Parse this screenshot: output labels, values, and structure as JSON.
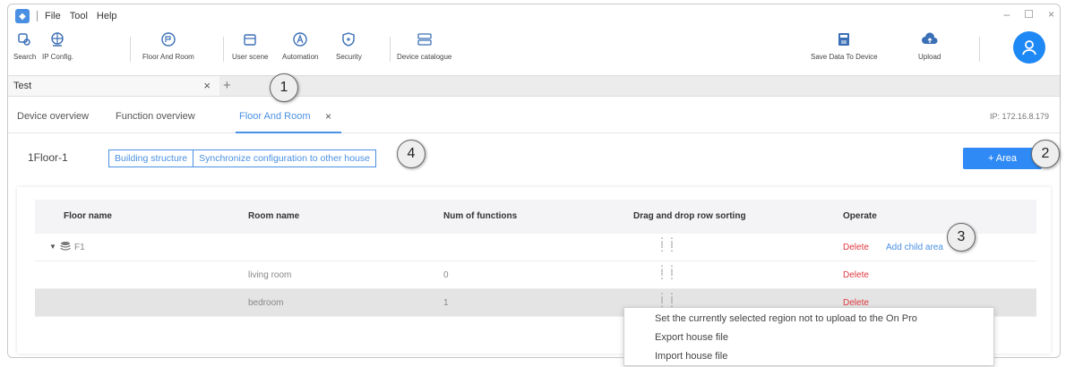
{
  "menu": [
    "File",
    "Tool",
    "Help"
  ],
  "window_controls": [
    "–",
    "☐",
    "×"
  ],
  "toolbar": {
    "search": "Search",
    "ip_config": "IP Config.",
    "floor_and_room": "Floor And Room",
    "user_scene": "User scene",
    "automation": "Automation",
    "security": "Security",
    "device_catalogue": "Device catalogue",
    "save_data": "Save Data To Device",
    "upload": "Upload"
  },
  "project_tab": {
    "name": "Test",
    "close": "×",
    "add": "+"
  },
  "page_tabs": {
    "device_overview": "Device overview",
    "function_overview": "Function overview",
    "floor_and_room": "Floor And Room",
    "close": "×"
  },
  "ip_label": "IP: 172.16.8.179",
  "floor": {
    "name": "1Floor-1",
    "building_structure": "Building structure",
    "sync_config": "Synchronize configuration to other house",
    "add_area": "+ Area"
  },
  "table": {
    "headers": {
      "floor_name": "Floor name",
      "room_name": "Room name",
      "num_functions": "Num of functions",
      "drag_sort": "Drag and drop row sorting",
      "operate": "Operate"
    },
    "floor_row": {
      "name": "F1",
      "delete": "Delete",
      "add_child": "Add child area"
    },
    "rooms": [
      {
        "name": "living room",
        "num": "0",
        "delete": "Delete"
      },
      {
        "name": "bedroom",
        "num": "1",
        "delete": "Delete"
      }
    ]
  },
  "context_menu": [
    "Set the currently selected region not to upload to the On Pro",
    "Export house file",
    "Import house file"
  ],
  "callouts": [
    "1",
    "2",
    "3",
    "4"
  ],
  "colors": {
    "accent": "#4a90e2",
    "primary_button": "#2f8af5",
    "danger": "#e0383e"
  }
}
